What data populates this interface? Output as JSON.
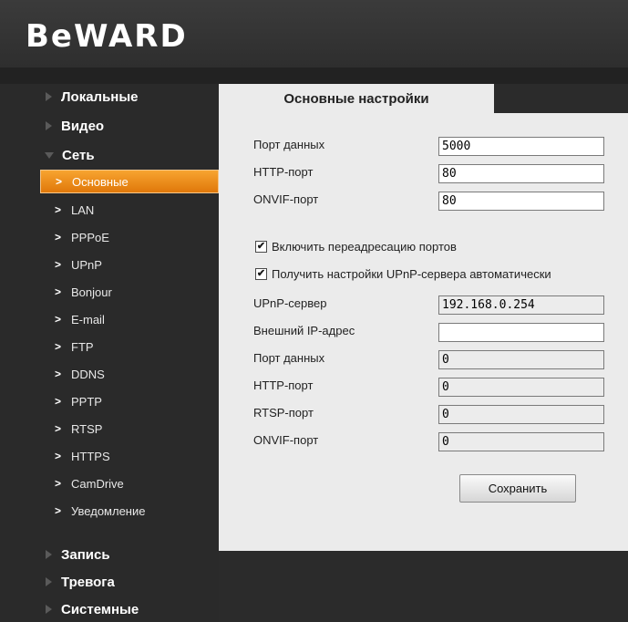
{
  "brand": {
    "logo_text": "BeWARD"
  },
  "sidebar": {
    "sections_top": [
      {
        "label": "Локальные",
        "expanded": false
      },
      {
        "label": "Видео",
        "expanded": false
      },
      {
        "label": "Сеть",
        "expanded": true
      }
    ],
    "network_items": [
      {
        "label": "Основные",
        "active": true
      },
      {
        "label": "LAN"
      },
      {
        "label": "PPPoE"
      },
      {
        "label": "UPnP"
      },
      {
        "label": "Bonjour"
      },
      {
        "label": "E-mail"
      },
      {
        "label": "FTP"
      },
      {
        "label": "DDNS"
      },
      {
        "label": "PPTP"
      },
      {
        "label": "RTSP"
      },
      {
        "label": "HTTPS"
      },
      {
        "label": "CamDrive"
      },
      {
        "label": "Уведомление"
      }
    ],
    "sections_bottom": [
      {
        "label": "Запись"
      },
      {
        "label": "Тревога"
      },
      {
        "label": "Системные"
      }
    ]
  },
  "tab": {
    "label": "Основные настройки"
  },
  "form": {
    "data_port_label": "Порт данных",
    "data_port_value": "5000",
    "http_port_label": "HTTP-порт",
    "http_port_value": "80",
    "onvif_port_label": "ONVIF-порт",
    "onvif_port_value": "80",
    "port_forwarding": {
      "label": "Включить переадресацию портов",
      "checked": true
    },
    "upnp_auto": {
      "label": "Получить настройки UPnP-сервера автоматически",
      "checked": true
    },
    "upnp_server_label": "UPnP-сервер",
    "upnp_server_value": "192.168.0.254",
    "external_ip_label": "Внешний IP-адрес",
    "external_ip_value": "",
    "ext_data_port_label": "Порт данных",
    "ext_data_port_value": "0",
    "ext_http_port_label": "HTTP-порт",
    "ext_http_port_value": "0",
    "ext_rtsp_port_label": "RTSP-порт",
    "ext_rtsp_port_value": "0",
    "ext_onvif_port_label": "ONVIF-порт",
    "ext_onvif_port_value": "0",
    "save_label": "Сохранить"
  },
  "colors": {
    "accent": "#f29a20",
    "panel": "#ebebeb",
    "background": "#2b2b2b"
  }
}
